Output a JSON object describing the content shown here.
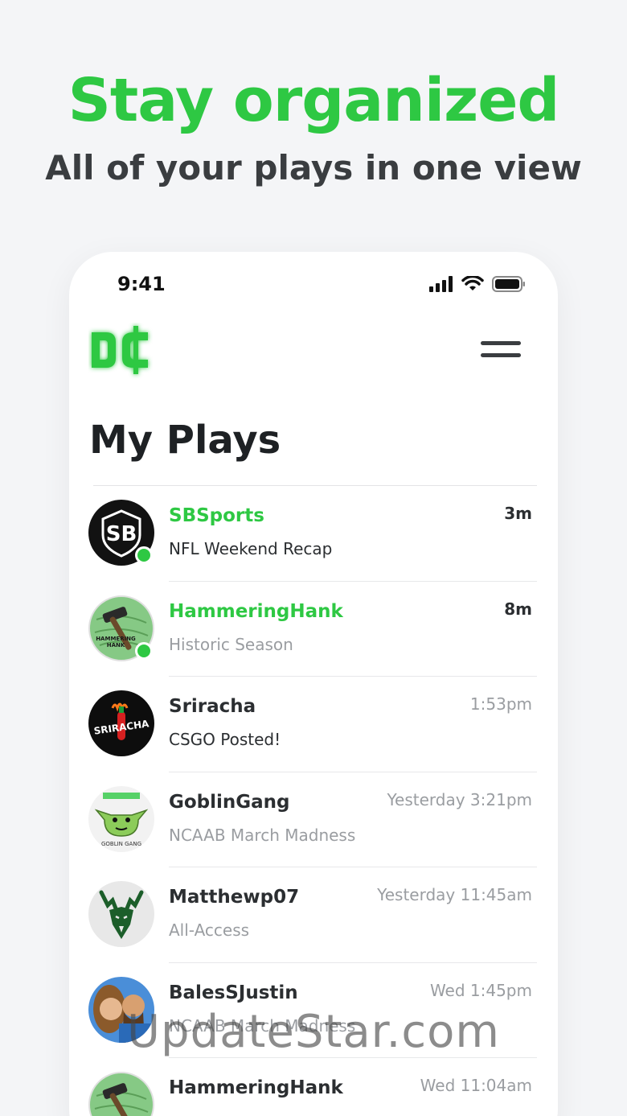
{
  "promo": {
    "headline": "Stay organized",
    "subhead": "All of your plays in one view"
  },
  "status_bar": {
    "time": "9:41",
    "icons": [
      "cellular-signal-icon",
      "wifi-icon",
      "battery-icon"
    ]
  },
  "header": {
    "logo_icon": "dc-logo-icon",
    "menu_icon": "hamburger-menu-icon"
  },
  "page": {
    "title": "My Plays"
  },
  "plays": [
    {
      "name": "SBSports",
      "preview": "NFL Weekend Recap",
      "time": "3m",
      "unread": true,
      "online": true,
      "avatar": "sbsports-avatar"
    },
    {
      "name": "HammeringHank",
      "preview": "Historic Season",
      "time": "8m",
      "unread": true,
      "online": true,
      "avatar": "hammer-avatar"
    },
    {
      "name": "Sriracha",
      "preview": "CSGO Posted!",
      "time": "1:53pm",
      "unread": false,
      "online": false,
      "avatar": "sriracha-avatar"
    },
    {
      "name": "GoblinGang",
      "preview": "NCAAB March Madness",
      "time": "Yesterday 3:21pm",
      "unread": false,
      "online": false,
      "avatar": "goblin-avatar"
    },
    {
      "name": "Matthewp07",
      "preview": "All-Access",
      "time": "Yesterday 11:45am",
      "unread": false,
      "online": false,
      "avatar": "deer-avatar"
    },
    {
      "name": "BalesSJustin",
      "preview": "NCAAB March Madness",
      "time": "Wed 1:45pm",
      "unread": false,
      "online": false,
      "avatar": "photo-avatar"
    },
    {
      "name": "HammeringHank",
      "preview": "",
      "time": "Wed 11:04am",
      "unread": false,
      "online": false,
      "avatar": "hammer-avatar"
    }
  ],
  "watermark": "UpdateStar.com",
  "colors": {
    "accent": "#2ec843",
    "text_dark": "#2b2e31",
    "text_muted": "#9a9da1"
  }
}
